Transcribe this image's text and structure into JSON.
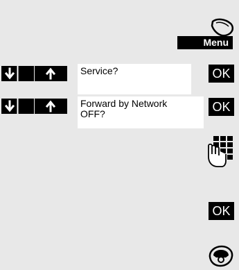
{
  "softkey": {
    "menu_label": "Menu"
  },
  "steps": [
    {
      "prompt": "Service?",
      "confirm_label": "OK"
    },
    {
      "prompt": "Forward by Network\nOFF?",
      "confirm_label": "OK"
    }
  ],
  "final_confirm_label": "OK",
  "icons": {
    "top": "handset-lift-icon",
    "nav_down": "arrow-down-icon",
    "nav_up": "arrow-up-icon",
    "keypad": "keypad-entry-icon",
    "bottom": "handset-hangup-icon"
  }
}
